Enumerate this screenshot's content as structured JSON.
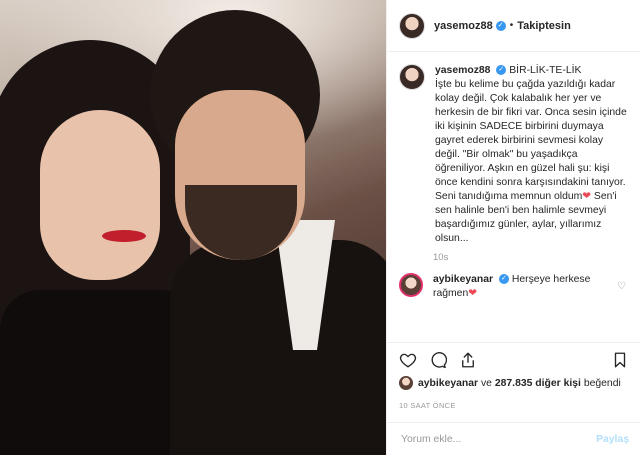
{
  "header": {
    "username": "yasemoz88",
    "follow_status": "Takiptesin"
  },
  "caption": {
    "username": "yasemoz88",
    "title": "BİR-LİK-TE-LİK",
    "body": "İşte bu kelime bu çağda yazıldığı kadar kolay değil. Çok kalabalık her yer ve herkesin de bir fikri var. Onca sesin içinde iki kişinin SADECE birbirini duymaya gayret ederek birbirini sevmesi kolay değil. \"Bir olmak\" bu yaşadıkça öğreniliyor. Aşkın en güzel hali şu: kişi önce kendini sonra karşısındakini tanıyor. Seni tanıdığıma memnun oldum",
    "body_after_heart1": " Sen'i sen halinle ben'i ben halimle sevmeyi başardığımız günler, aylar, yıllarımız olsun...",
    "heart": "❤",
    "time": "10s"
  },
  "comment": {
    "username": "aybikeyanar",
    "text": "Herşeye herkese rağmen",
    "heart": "❤"
  },
  "icons": {
    "like": "heart-outline-icon",
    "comment": "speech-bubble-icon",
    "share": "share-icon",
    "save": "bookmark-icon",
    "verified": "verified-badge-icon"
  },
  "likes": {
    "username": "aybikeyanar",
    "connector": "ve",
    "count_text": "287.835 diğer kişi",
    "suffix": "beğendi"
  },
  "time_ago": "10 SAAT ÖNCE",
  "add_comment": {
    "placeholder": "Yorum ekle...",
    "post_label": "Paylaş"
  },
  "colors": {
    "verified": "#3897f0",
    "heart": "#ed4956",
    "post_disabled": "#b2dffc"
  }
}
